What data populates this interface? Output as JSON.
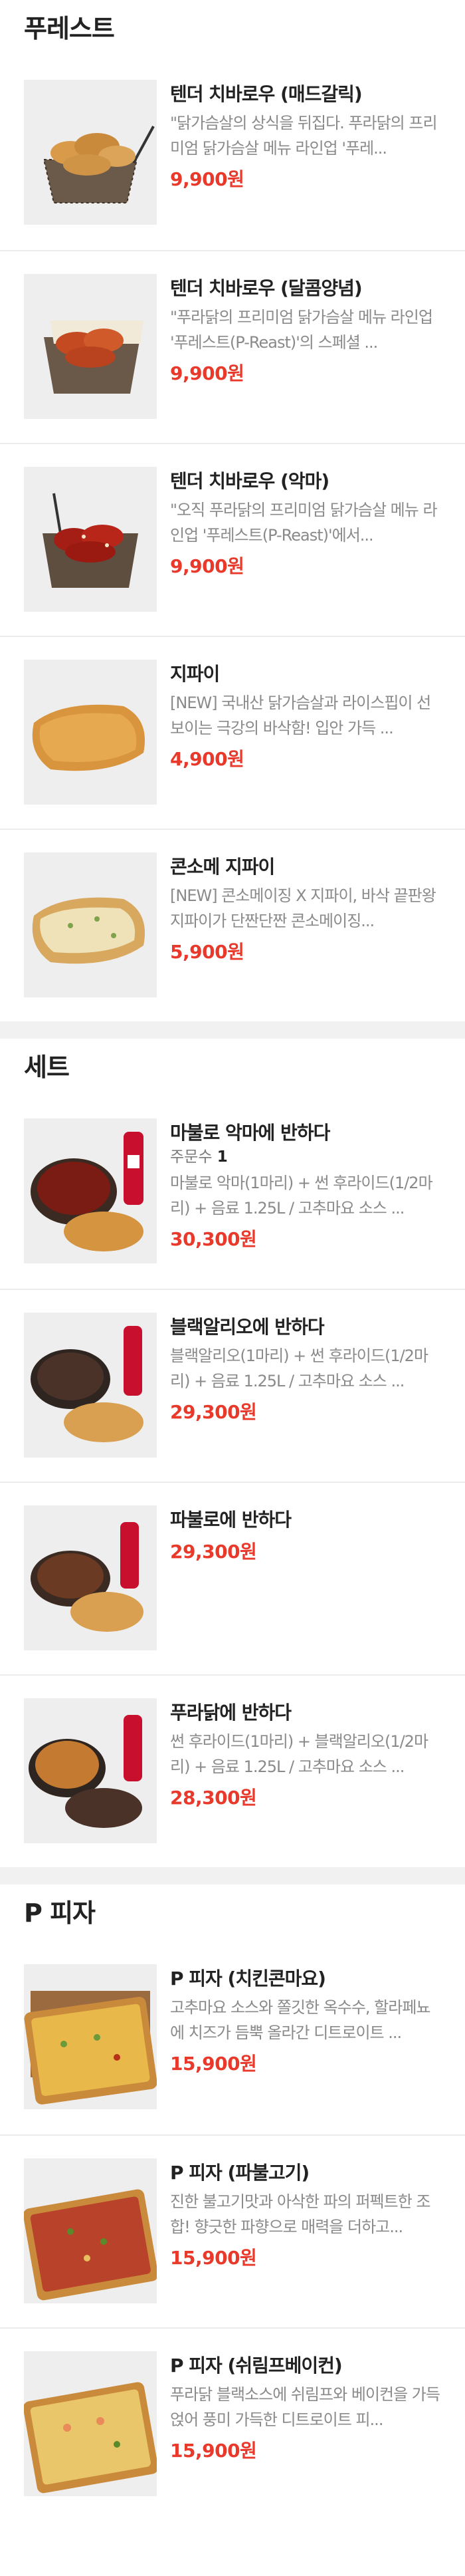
{
  "sections": [
    {
      "title": "푸레스트",
      "items": [
        {
          "name": "텐더 치바로우 (매드갈릭)",
          "desc": "\"닭가슴살의 상식을 뒤집다. 푸라닭의 프리미엄 닭가슴살 메뉴 라인업 '푸레...",
          "price": "9,900원"
        },
        {
          "name": "텐더 치바로우 (달콤양념)",
          "desc": "\"푸라닭의 프리미엄 닭가슴살 메뉴 라인업 '푸레스트(P-Reast)'의 스페셜 ...",
          "price": "9,900원"
        },
        {
          "name": "텐더 치바로우 (악마)",
          "desc": "\"오직 푸라닭의 프리미엄 닭가슴살 메뉴 라인업 '푸레스트(P-Reast)'에서...",
          "price": "9,900원"
        },
        {
          "name": "지파이",
          "desc": "[NEW] 국내산 닭가슴살과 라이스핍이 선보이는 극강의 바삭함! 입안 가득 ...",
          "price": "4,900원"
        },
        {
          "name": "콘소메 지파이",
          "desc": "[NEW] 콘소메이징 X 지파이, 바삭 끝판왕 지파이가 단짠단짠 콘소메이징...",
          "price": "5,900원"
        }
      ]
    },
    {
      "title": "세트",
      "items": [
        {
          "name": "마불로 악마에 반하다",
          "meta_label": "주문수",
          "meta_value": "1",
          "desc": "마불로 악마(1마리) + 썬 후라이드(1/2마리) + 음료 1.25L / 고추마요 소스 ...",
          "price": "30,300원"
        },
        {
          "name": "블랙알리오에 반하다",
          "desc": "블랙알리오(1마리) + 썬 후라이드(1/2마리) + 음료 1.25L / 고추마요 소스 ...",
          "price": "29,300원"
        },
        {
          "name": "파불로에 반하다",
          "desc": "",
          "price": "29,300원"
        },
        {
          "name": "푸라닭에 반하다",
          "desc": "썬 후라이드(1마리) + 블랙알리오(1/2마리) + 음료 1.25L / 고추마요 소스 ...",
          "price": "28,300원"
        }
      ]
    },
    {
      "title": "P 피자",
      "items": [
        {
          "name": "P 피자 (치킨콘마요)",
          "desc": "고추마요 소스와 쫄깃한 옥수수, 할라페뇨에 치즈가 듬뿍 올라간 디트로이트 ...",
          "price": "15,900원"
        },
        {
          "name": "P 피자 (파불고기)",
          "desc": "진한 불고기맛과 아삭한 파의 퍼펙트한 조합! 향긋한 파향으로 매력을 더하고...",
          "price": "15,900원"
        },
        {
          "name": "P 피자 (쉬림프베이컨)",
          "desc": "푸라닭 블랙소스에 쉬림프와 베이컨을 가득 얹어 풍미 가득한 디트로이트 피...",
          "price": "15,900원"
        }
      ]
    }
  ]
}
